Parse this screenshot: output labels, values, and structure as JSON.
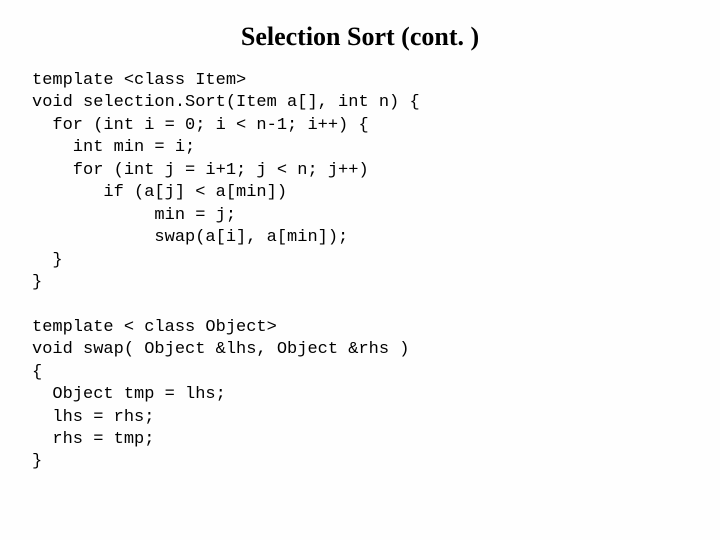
{
  "title": "Selection Sort (cont. )",
  "code": "template <class Item>\nvoid selection.Sort(Item a[], int n) {\n  for (int i = 0; i < n-1; i++) {\n    int min = i;\n    for (int j = i+1; j < n; j++)\n       if (a[j] < a[min])\n            min = j;\n            swap(a[i], a[min]);\n  }\n}\n\ntemplate < class Object>\nvoid swap( Object &lhs, Object &rhs )\n{\n  Object tmp = lhs;\n  lhs = rhs;\n  rhs = tmp;\n}"
}
